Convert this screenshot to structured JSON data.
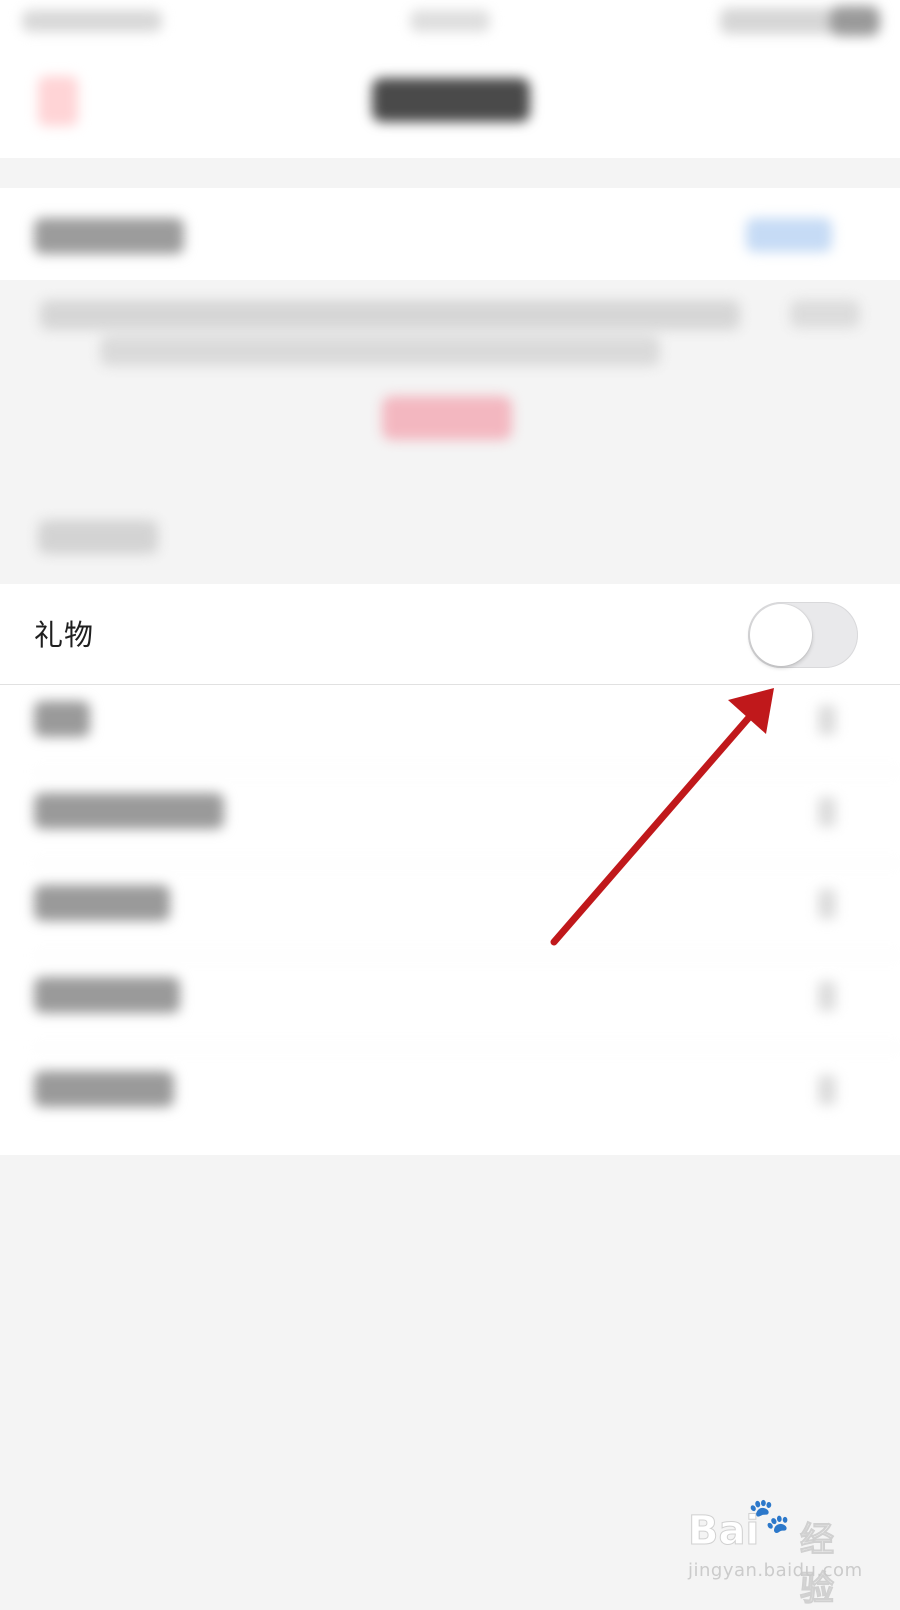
{
  "settings": {
    "gift_row": {
      "label": "礼物",
      "toggle_on": false
    }
  },
  "colors": {
    "toggle_off_track": "#e9e9eb",
    "toggle_knob": "#ffffff",
    "annotation_arrow": "#c0181b",
    "page_background": "#f4f4f4"
  },
  "watermark": {
    "logo_text": "Bai",
    "logo_suffix": "经验",
    "url": "jingyan.baidu.com"
  }
}
